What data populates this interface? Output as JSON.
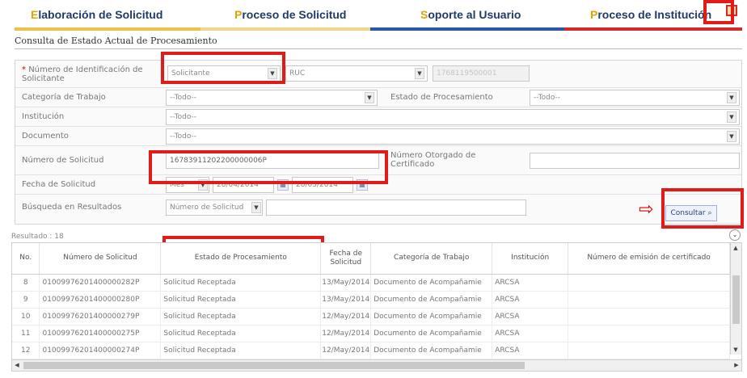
{
  "tabs": [
    {
      "first_letter": "E",
      "rest": "laboración de Solicitud"
    },
    {
      "first_letter": "P",
      "rest": "roceso de Solicitud"
    },
    {
      "first_letter": "S",
      "rest": "oporte al Usuario"
    },
    {
      "first_letter": "P",
      "rest": "roceso de Institución"
    }
  ],
  "section_title": "Consulta de Estado Actual de Procesamiento",
  "form": {
    "id_label": "Número de Identificación de Solicitante",
    "id_type_value": "Solicitante",
    "id_doc_value": "RUC",
    "id_number_value": "1768119500001",
    "categoria_label": "Categoría de Trabajo",
    "categoria_value": "--Todo--",
    "estado_label": "Estado de Procesamiento",
    "estado_value": "--Todo--",
    "institucion_label": "Institución",
    "institucion_value": "--Todo--",
    "documento_label": "Documento",
    "documento_value": "--Todo--",
    "num_solicitud_label": "Número de Solicitud",
    "num_solicitud_value": "16783911202200000006P",
    "num_cert_label": "Número Otorgado de Certificado",
    "num_cert_value": "",
    "fecha_label": "Fecha de Solicitud",
    "fecha_period": "Mes",
    "fecha_from": "28/04/2014",
    "fecha_to": "28/05/2014",
    "busqueda_label": "Búsqueda en Resultados",
    "busqueda_field": "Número de Solicitud",
    "busqueda_value": "",
    "consultar_label": "Consultar",
    "required_mark": "*"
  },
  "results_count": "Resultado : 18",
  "table": {
    "headers": [
      "No.",
      "Número de Solicitud",
      "Estado de Procesamiento",
      "Fecha de Solicitud",
      "Categoría de Trabajo",
      "Institución",
      "Número de emisión de certificado"
    ],
    "rows": [
      [
        "8",
        "0100997620140000028​2P",
        "Solicitud Receptada",
        "13/May/2014",
        "Documento de Acompañamie",
        "ARCSA",
        ""
      ],
      [
        "9",
        "0100997620140000028​0P",
        "Solicitud Receptada",
        "13/May/2014",
        "Documento de Acompañamie",
        "ARCSA",
        ""
      ],
      [
        "10",
        "0100997620140000027​9P",
        "Solicitud Receptada",
        "12/May/2014",
        "Documento de Acompañamie",
        "ARCSA",
        ""
      ],
      [
        "11",
        "0100997620140000027​5P",
        "Solicitud Receptada",
        "12/May/2014",
        "Documento de Acompañamie",
        "ARCSA",
        ""
      ],
      [
        "12",
        "0100997620140000027​4P",
        "Solicitud Receptada",
        "12/May/2014",
        "Documento de Acompañamie",
        "ARCSA",
        ""
      ]
    ]
  },
  "colors": {
    "tab_text": "#1f3a6b",
    "tab_first_letter": "#e0a300",
    "highlight_red": "#e11a1a",
    "tab_line_1": "#e8c24a",
    "tab_line_2": "#f0d58c",
    "tab_line_3": "#2d55a8",
    "tab_line_4": "#d32a2a"
  },
  "icons": {
    "dropdown": "▼",
    "calendar": "▦",
    "arrow": "⇨",
    "search": "⌕",
    "collapse": "⌄"
  }
}
